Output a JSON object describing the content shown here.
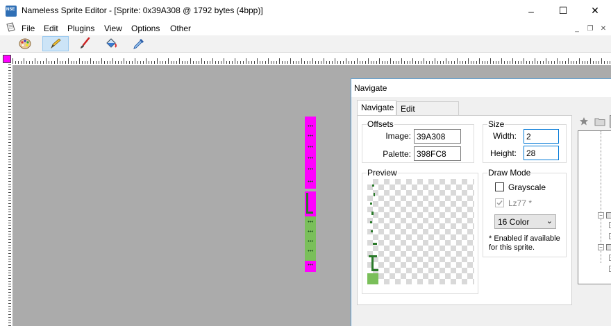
{
  "window": {
    "title": "Nameless Sprite Editor - [Sprite: 0x39A308 @ 1792 bytes (4bpp)]",
    "app_icon_text": "NSE",
    "minimize": "–",
    "maximize": "☐",
    "close": "✕"
  },
  "menu": {
    "items": [
      "File",
      "Edit",
      "Plugins",
      "View",
      "Options",
      "Other"
    ],
    "mdi_minimize": "_",
    "mdi_restore": "❐",
    "mdi_close": "✕"
  },
  "toolbar": {
    "tools": [
      {
        "icon": "palette-icon",
        "active": false
      },
      {
        "icon": "pencil-icon",
        "active": true
      },
      {
        "icon": "brush-icon",
        "active": false
      },
      {
        "icon": "fill-bucket-icon",
        "active": false
      },
      {
        "icon": "eyedropper-icon",
        "active": false
      }
    ]
  },
  "navigate": {
    "title": "Navigate",
    "tabs": [
      "Navigate",
      "Edit BookMarks"
    ],
    "offsets": {
      "label": "Offsets",
      "image_label": "Image:",
      "image_value": "39A308",
      "palette_label": "Palette:",
      "palette_value": "398FC8"
    },
    "size": {
      "label": "Size",
      "width_label": "Width:",
      "width_value": "2",
      "height_label": "Height:",
      "height_value": "28"
    },
    "preview": {
      "label": "Preview"
    },
    "draw_mode": {
      "label": "Draw Mode",
      "grayscale_label": "Grayscale",
      "grayscale_checked": false,
      "lz77_label": "Lz77 *",
      "lz77_checked": true,
      "lz77_enabled": false,
      "color_select": "16 Color",
      "note": "* Enabled if available for this sprite."
    },
    "side_icons": [
      "star-icon",
      "folder-icon"
    ]
  },
  "colors": {
    "canvas_bg": "#ababab",
    "sprite_magenta": "#ff00ff",
    "sprite_green": "#7abf5a",
    "selected_tool": "#cce4f7",
    "focus_border": "#0078d7"
  }
}
